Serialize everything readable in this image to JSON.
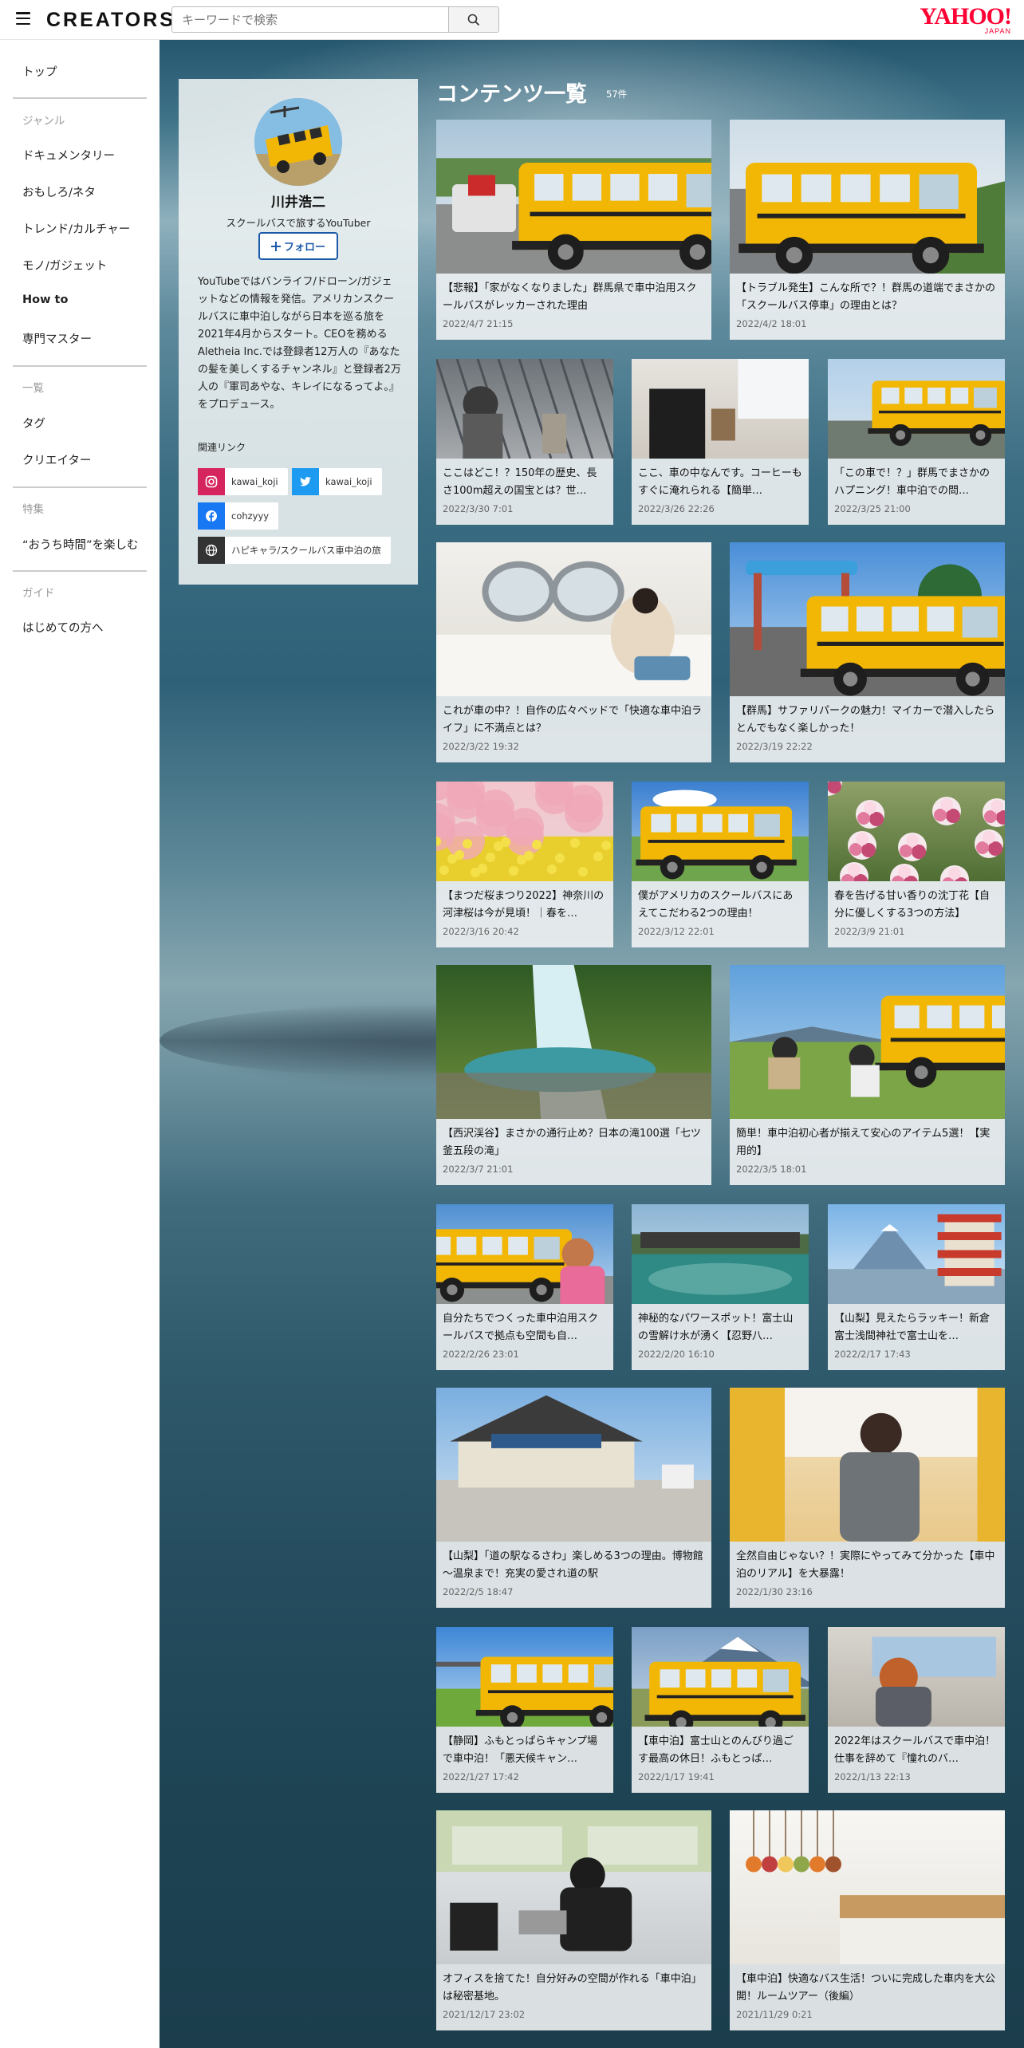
{
  "header": {
    "logo": "CREATORS",
    "search_placeholder": "キーワードで検索",
    "yahoo_logo": "YAHOO!",
    "yahoo_sub": "JAPAN"
  },
  "sidebar": {
    "top": "トップ",
    "genre_head": "ジャンル",
    "genres": [
      "ドキュメンタリー",
      "おもしろ/ネタ",
      "トレンド/カルチャー",
      "モノ/ガジェット",
      "How to",
      "専門マスター"
    ],
    "list_head": "一覧",
    "lists": [
      "タグ",
      "クリエイター"
    ],
    "feature_head": "特集",
    "features": [
      "“おうち時間”を楽しむ"
    ],
    "guide_head": "ガイド",
    "guides": [
      "はじめての方へ"
    ]
  },
  "profile": {
    "name": "川井浩二",
    "subtitle": "スクールバスで旅するYouTuber",
    "follow_label": "フォロー",
    "description": "YouTubeではバンライフ/ドローン/ガジェットなどの情報を発信。アメリカンスクールバスに車中泊しながら日本を巡る旅を2021年4月からスタート。CEOを務めるAletheia Inc.では登録者12万人の『あなたの髪を美しくするチャンネル』と登録者2万人の『軍司あやな、キレイになるってよ。』をプロデュース。",
    "links_label": "関連リンク",
    "links": [
      {
        "service": "instagram",
        "label": "kawai_koji",
        "color": "#d6245e",
        "icon": "instagram-icon"
      },
      {
        "service": "twitter",
        "label": "kawai_koji",
        "color": "#1d9bf0",
        "icon": "twitter-icon"
      },
      {
        "service": "facebook",
        "label": "cohzyyy",
        "color": "#1877f2",
        "icon": "facebook-icon"
      },
      {
        "service": "website",
        "label": "ハピキャラ/スクールバス車中泊の旅",
        "color": "#333333",
        "icon": "globe-icon"
      }
    ]
  },
  "content": {
    "title": "コンテンツ一覧",
    "count": "57件",
    "cards": [
      {
        "title": "【悲報】「家がなくなりました」群馬県で車中泊用スクールバスがレッカーされた理由",
        "date": "2022/4/7 21:15",
        "scene": "bus-tow"
      },
      {
        "title": "【トラブル発生】こんな所で？！群馬の道端でまさかの「スクールバス停車」の理由とは？",
        "date": "2022/4/2 18:01",
        "scene": "bus-road"
      },
      {
        "title": "ここはどこ！？150年の歴史、長さ100m超えの国宝とは？世…",
        "date": "2022/3/30 7:01",
        "scene": "factory"
      },
      {
        "title": "ここ、車の中なんです。コーヒーもすぐに淹れられる【簡単…",
        "date": "2022/3/26 22:26",
        "scene": "coffee"
      },
      {
        "title": "「この車で！？」群馬でまさかのハプニング！車中泊での問…",
        "date": "2022/3/25 21:00",
        "scene": "bus-small"
      },
      {
        "title": "これが車の中？！自作の広々ベッドで「快適な車中泊ライフ」に不満点とは？",
        "date": "2022/3/22 19:32",
        "scene": "bed"
      },
      {
        "title": "【群馬】サファリパークの魅力！マイカーで潜入したらとんでもなく楽しかった！",
        "date": "2022/3/19 22:22",
        "scene": "safari"
      },
      {
        "title": "【まつだ桜まつり2022】神奈川の河津桜は今が見頃！｜春を…",
        "date": "2022/3/16 20:42",
        "scene": "sakura"
      },
      {
        "title": "僕がアメリカのスクールバスにあえてこだわる2つの理由！",
        "date": "2022/3/12 22:01",
        "scene": "bus-field"
      },
      {
        "title": "春を告げる甘い香りの沈丁花【自分に優しくする3つの方法】",
        "date": "2022/3/9 21:01",
        "scene": "flowers"
      },
      {
        "title": "【西沢渓谷】まさかの通行止め？日本の滝100選「七ツ釜五段の滝」",
        "date": "2022/3/7 21:01",
        "scene": "waterfall"
      },
      {
        "title": "簡単！車中泊初心者が揃えて安心のアイテム5選！【実用的】",
        "date": "2022/3/5 18:01",
        "scene": "camp"
      },
      {
        "title": "自分たちでつくった車中泊用スクールバスで拠点も空間も自…",
        "date": "2022/2/26 23:01",
        "scene": "bus-woman"
      },
      {
        "title": "神秘的なパワースポット！富士山の雪解け水が湧く【忍野八…",
        "date": "2022/2/20 16:10",
        "scene": "pond"
      },
      {
        "title": "【山梨】見えたらラッキー！新倉富士浅間神社で富士山を…",
        "date": "2022/2/17 17:43",
        "scene": "pagoda"
      },
      {
        "title": "【山梨】「道の駅なるさわ」楽しめる3つの理由。博物館～温泉まで！充実の愛され道の駅",
        "date": "2022/2/5 18:47",
        "scene": "museum"
      },
      {
        "title": "全然自由じゃない？！実際にやってみて分かった【車中泊のリアル】を大暴露！",
        "date": "2022/1/30 23:16",
        "scene": "driver"
      },
      {
        "title": "【静岡】ふもとっぱらキャンプ場で車中泊！「悪天候キャン…",
        "date": "2022/1/27 17:42",
        "scene": "bus-camp"
      },
      {
        "title": "【車中泊】富士山とのんびり過ごす最高の休日！ふもとっぱ…",
        "date": "2022/1/17 19:41",
        "scene": "bus-fuji"
      },
      {
        "title": "2022年はスクールバスで車中泊！仕事を辞めて『憧れのバ…",
        "date": "2022/1/13 22:13",
        "scene": "woman-window"
      },
      {
        "title": "オフィスを捨てた！自分好みの空間が作れる「車中泊」は秘密基地。",
        "date": "2021/12/17 23:02",
        "scene": "office"
      },
      {
        "title": "【車中泊】快適なバス生活！ついに完成した車内を大公開！ルームツアー（後編）",
        "date": "2021/11/29 0:21",
        "scene": "kitchen"
      }
    ]
  }
}
